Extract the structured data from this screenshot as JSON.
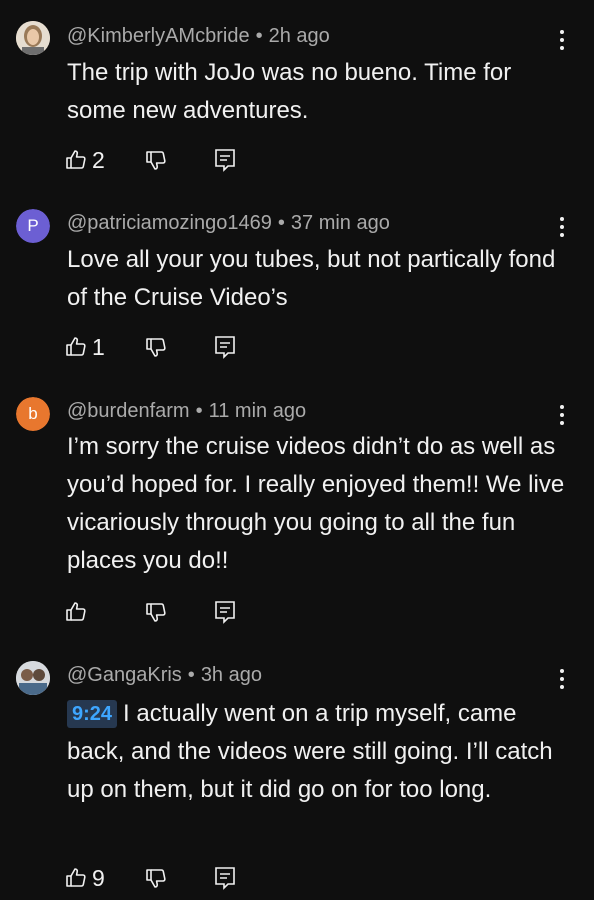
{
  "comments": [
    {
      "author": "@KimberlyAMcbride",
      "age": "2h ago",
      "text": "The trip with JoJo was no bueno.  Time for some new adventures.",
      "likes": "2",
      "avatar_type": "photo",
      "avatar_color": "#b9a48a"
    },
    {
      "author": "@patriciamozingo1469",
      "age": "37 min ago",
      "text": "Love all your you tubes, but not partically fond of the Cruise Video’s",
      "likes": "1",
      "avatar_type": "letter",
      "avatar_letter": "P",
      "avatar_color": "#6c5fd3"
    },
    {
      "author": "@burdenfarm",
      "age": "11 min ago",
      "text": "I’m sorry the cruise videos didn’t do as well as you’d hoped for. I really enjoyed them!!  We live vicariously through you going to all the fun places you do!!",
      "likes": "",
      "avatar_type": "letter",
      "avatar_letter": "b",
      "avatar_color": "#e8772e"
    },
    {
      "author": "@GangaKris",
      "age": "3h ago",
      "timestamp_link": "9:24",
      "text": "I actually went on a trip myself, came back, and the videos were still going. I’ll catch up on them, but it did go on for too long.",
      "likes": "9",
      "avatar_type": "photo",
      "avatar_color": "#8a8f99"
    }
  ],
  "icons": {
    "like": "thumbs-up-icon",
    "dislike": "thumbs-down-icon",
    "reply": "reply-icon",
    "menu": "more-vert-icon"
  },
  "colors": {
    "background": "#0f0f0f",
    "text": "#f1f1f1",
    "meta": "#aaaaaa",
    "link": "#3ea6ff",
    "timestamp_bg": "#263850"
  }
}
